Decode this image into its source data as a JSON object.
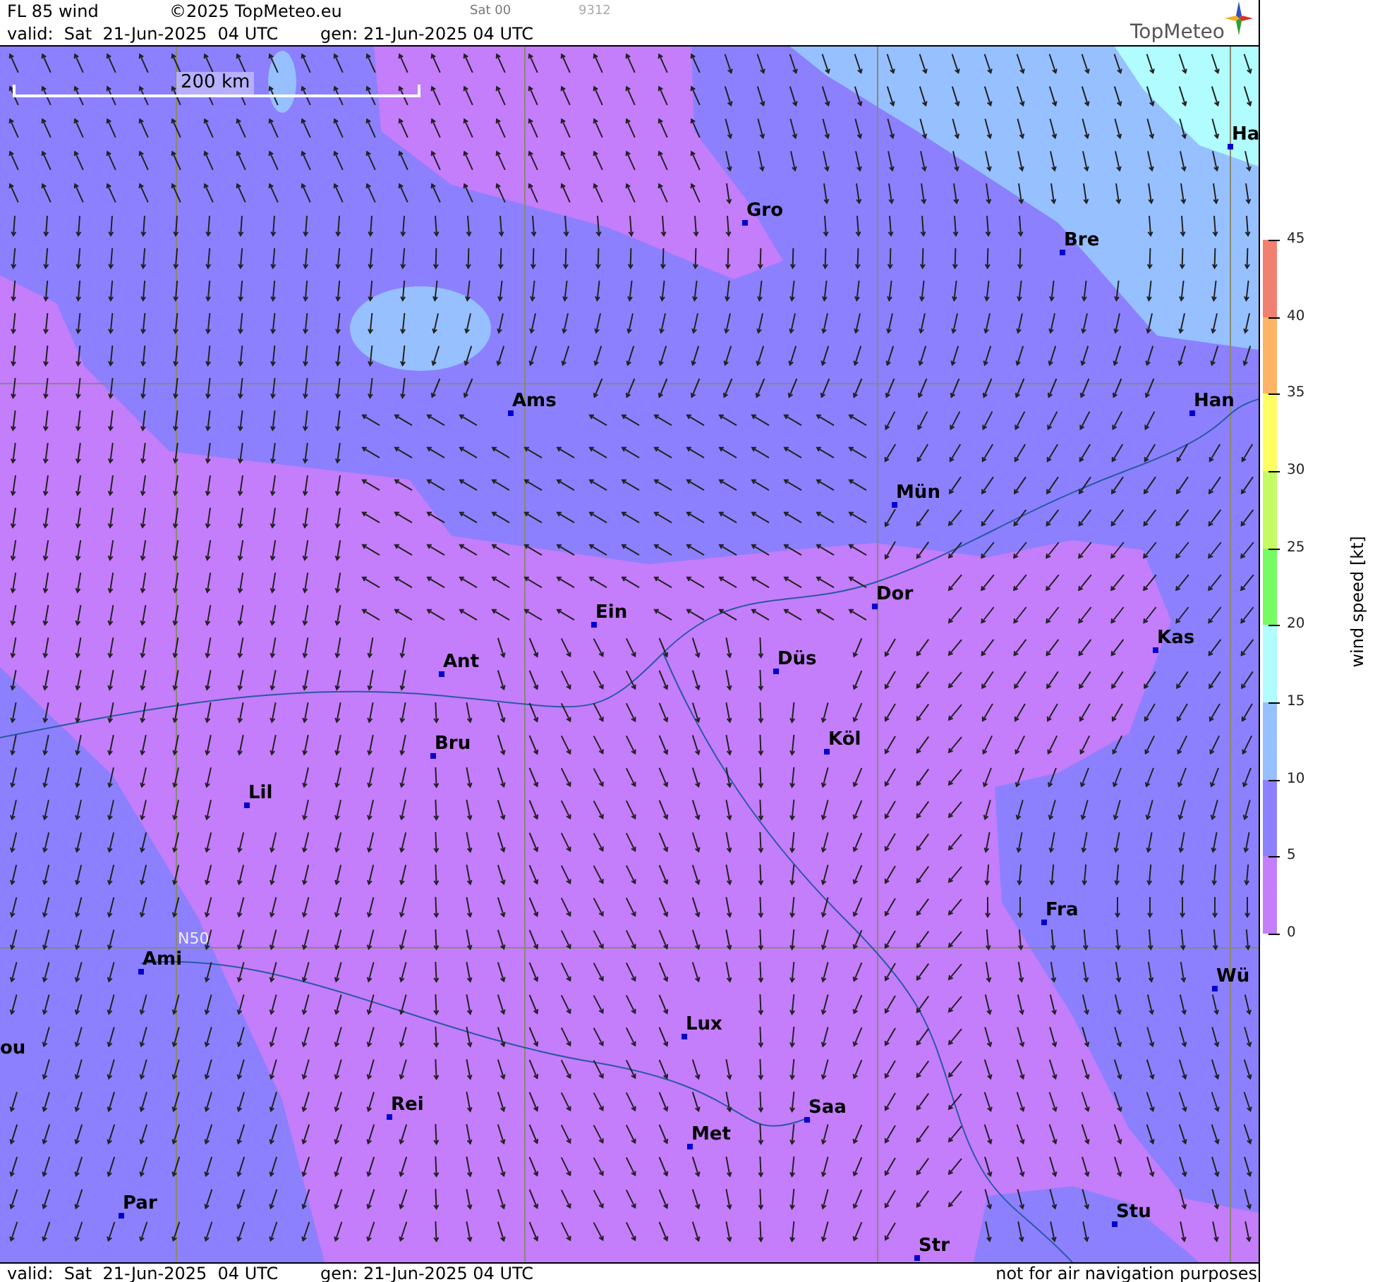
{
  "header": {
    "title": "FL 85 wind",
    "copyright": "©2025 TopMeteo.eu",
    "run": "Sat 00",
    "code": "9312",
    "valid": "valid:  Sat  21-Jun-2025  04 UTC",
    "generated": "gen: 21-Jun-2025 04 UTC",
    "logo": "TopMeteo"
  },
  "map": {
    "scale_label": "200 km",
    "gridline_label": "N50",
    "cities": [
      {
        "name": "Ha"
      },
      {
        "name": "Gro"
      },
      {
        "name": "Bre"
      },
      {
        "name": "Ams"
      },
      {
        "name": "Han"
      },
      {
        "name": "Mün"
      },
      {
        "name": "Dor"
      },
      {
        "name": "Ein"
      },
      {
        "name": "Kas"
      },
      {
        "name": "Ant"
      },
      {
        "name": "Düs"
      },
      {
        "name": "Köl"
      },
      {
        "name": "Bru"
      },
      {
        "name": "Lil"
      },
      {
        "name": "Fra"
      },
      {
        "name": "Ami"
      },
      {
        "name": "Wü"
      },
      {
        "name": "ou"
      },
      {
        "name": "Lux"
      },
      {
        "name": "Rei"
      },
      {
        "name": "Saa"
      },
      {
        "name": "Met"
      },
      {
        "name": "Par"
      },
      {
        "name": "Stu"
      },
      {
        "name": "Str"
      }
    ]
  },
  "legend": {
    "title": "wind speed [kt]",
    "ticks": [
      "45",
      "40",
      "35",
      "30",
      "25",
      "20",
      "15",
      "10",
      "5",
      "0"
    ],
    "bands": [
      {
        "color": "#f08070"
      },
      {
        "color": "#feb464"
      },
      {
        "color": "#fefe64"
      },
      {
        "color": "#c4fb64"
      },
      {
        "color": "#76fb64"
      },
      {
        "color": "#b0fcff"
      },
      {
        "color": "#96c0ff"
      },
      {
        "color": "#8c80ff"
      },
      {
        "color": "#c47dfb"
      }
    ]
  },
  "footer": {
    "valid": "valid:  Sat  21-Jun-2025  04 UTC",
    "generated": "gen: 21-Jun-2025 04 UTC",
    "notice": "not for air navigation purposes"
  }
}
